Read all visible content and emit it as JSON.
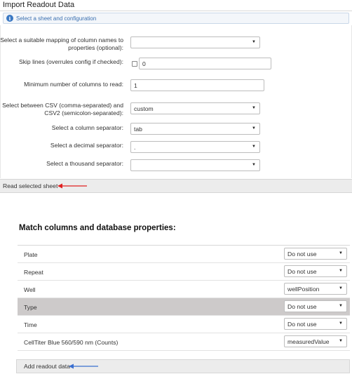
{
  "page": {
    "title": "Import Readout Data"
  },
  "step": {
    "info_glyph": "i",
    "label": "Select a sheet and configuration"
  },
  "config": {
    "mapping": {
      "label": "Select a suitable mapping of column names to properties (optional):",
      "value": ""
    },
    "skip_lines": {
      "label": "Skip lines (overrules config if checked):",
      "checked": false,
      "value": "0"
    },
    "min_columns": {
      "label": "Minimum number of columns to read:",
      "value": "1"
    },
    "csv_mode": {
      "label": "Select between CSV (comma-separated) and CSV2 (semicolon-separated):",
      "value": "custom"
    },
    "column_separator": {
      "label": "Select a column separator:",
      "value": "tab"
    },
    "decimal_separator": {
      "label": "Select a decimal separator:",
      "value": "."
    },
    "thousand_separator": {
      "label": "Select a thousand separator:",
      "value": ""
    }
  },
  "read_sheet": {
    "label": "Read selected sheet",
    "arrow_color": "#e02020"
  },
  "match": {
    "title": "Match columns and database properties:",
    "rows": [
      {
        "label": "Plate",
        "value": "Do not use"
      },
      {
        "label": "Repeat",
        "value": "Do not use"
      },
      {
        "label": "Well",
        "value": "wellPosition"
      },
      {
        "label": "Type",
        "value": "Do not use",
        "highlighted": true
      },
      {
        "label": "Time",
        "value": "Do not use"
      },
      {
        "label": "CellTiter Blue 560/590 nm (Counts)",
        "value": "measuredValue"
      }
    ]
  },
  "add_readout": {
    "label": "Add readout data",
    "arrow_color": "#3a6fd0"
  }
}
